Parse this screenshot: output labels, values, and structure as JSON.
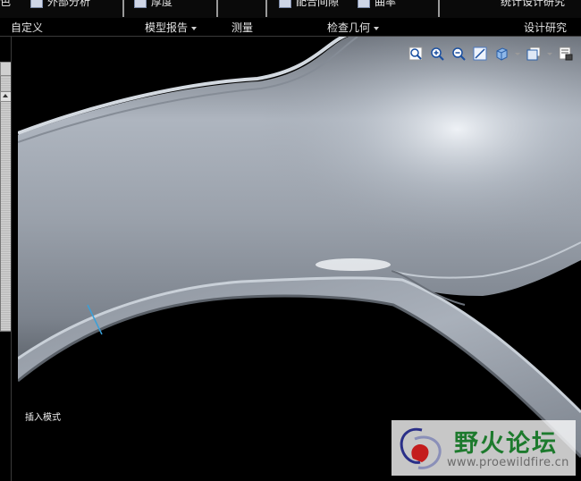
{
  "ribbon_top": {
    "items": [
      {
        "label": "色"
      },
      {
        "label": "外部分析"
      },
      {
        "label": "厚度"
      },
      {
        "label": "配合间隙"
      },
      {
        "label": "曲率"
      },
      {
        "label": "统计设计研究"
      }
    ]
  },
  "group_bar": {
    "custom": "自定义",
    "model_report": "模型报告",
    "measure": "测量",
    "inspect_geometry": "检查几何",
    "design_study": "设计研究"
  },
  "view_toolbar": {
    "icons": [
      "refit-icon",
      "zoom-in-icon",
      "zoom-out-icon",
      "repaint-icon",
      "display-style-icon",
      "saved-views-icon",
      "view-manager-icon"
    ]
  },
  "viewport": {
    "mode_text": "插入模式"
  },
  "watermark": {
    "title": "野火论坛",
    "url": "www.proewildfire.cn"
  },
  "colors": {
    "background": "#000000",
    "model_surface": "#9aa2ac",
    "edge_highlight": "#c9d0d8",
    "datum_line": "#3aa0d8",
    "watermark_green": "#1d7a2d"
  }
}
